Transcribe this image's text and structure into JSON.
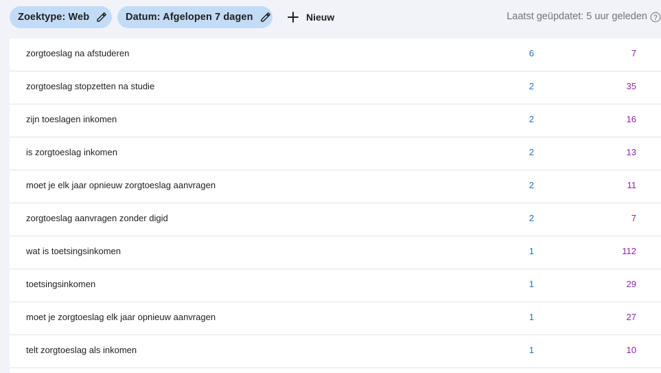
{
  "filters": {
    "search_type": "Zoektype: Web",
    "date": "Datum: Afgelopen 7 dagen",
    "new_label": "Nieuw"
  },
  "status": {
    "last_updated": "Laatst geüpdatet: 5 uur geleden"
  },
  "colors": {
    "chip_bg": "#c2dbf7",
    "clicks": "#1a73c8",
    "impressions": "#8e24aa"
  },
  "rows": [
    {
      "query": "zorgtoeslag na afstuderen",
      "clicks": "6",
      "impressions": "7"
    },
    {
      "query": "zorgtoeslag stopzetten na studie",
      "clicks": "2",
      "impressions": "35"
    },
    {
      "query": "zijn toeslagen inkomen",
      "clicks": "2",
      "impressions": "16"
    },
    {
      "query": "is zorgtoeslag inkomen",
      "clicks": "2",
      "impressions": "13"
    },
    {
      "query": "moet je elk jaar opnieuw zorgtoeslag aanvragen",
      "clicks": "2",
      "impressions": "11"
    },
    {
      "query": "zorgtoeslag aanvragen zonder digid",
      "clicks": "2",
      "impressions": "7"
    },
    {
      "query": "wat is toetsingsinkomen",
      "clicks": "1",
      "impressions": "112"
    },
    {
      "query": "toetsingsinkomen",
      "clicks": "1",
      "impressions": "29"
    },
    {
      "query": "moet je zorgtoeslag elk jaar opnieuw aanvragen",
      "clicks": "1",
      "impressions": "27"
    },
    {
      "query": "telt zorgtoeslag als inkomen",
      "clicks": "1",
      "impressions": "10"
    }
  ]
}
